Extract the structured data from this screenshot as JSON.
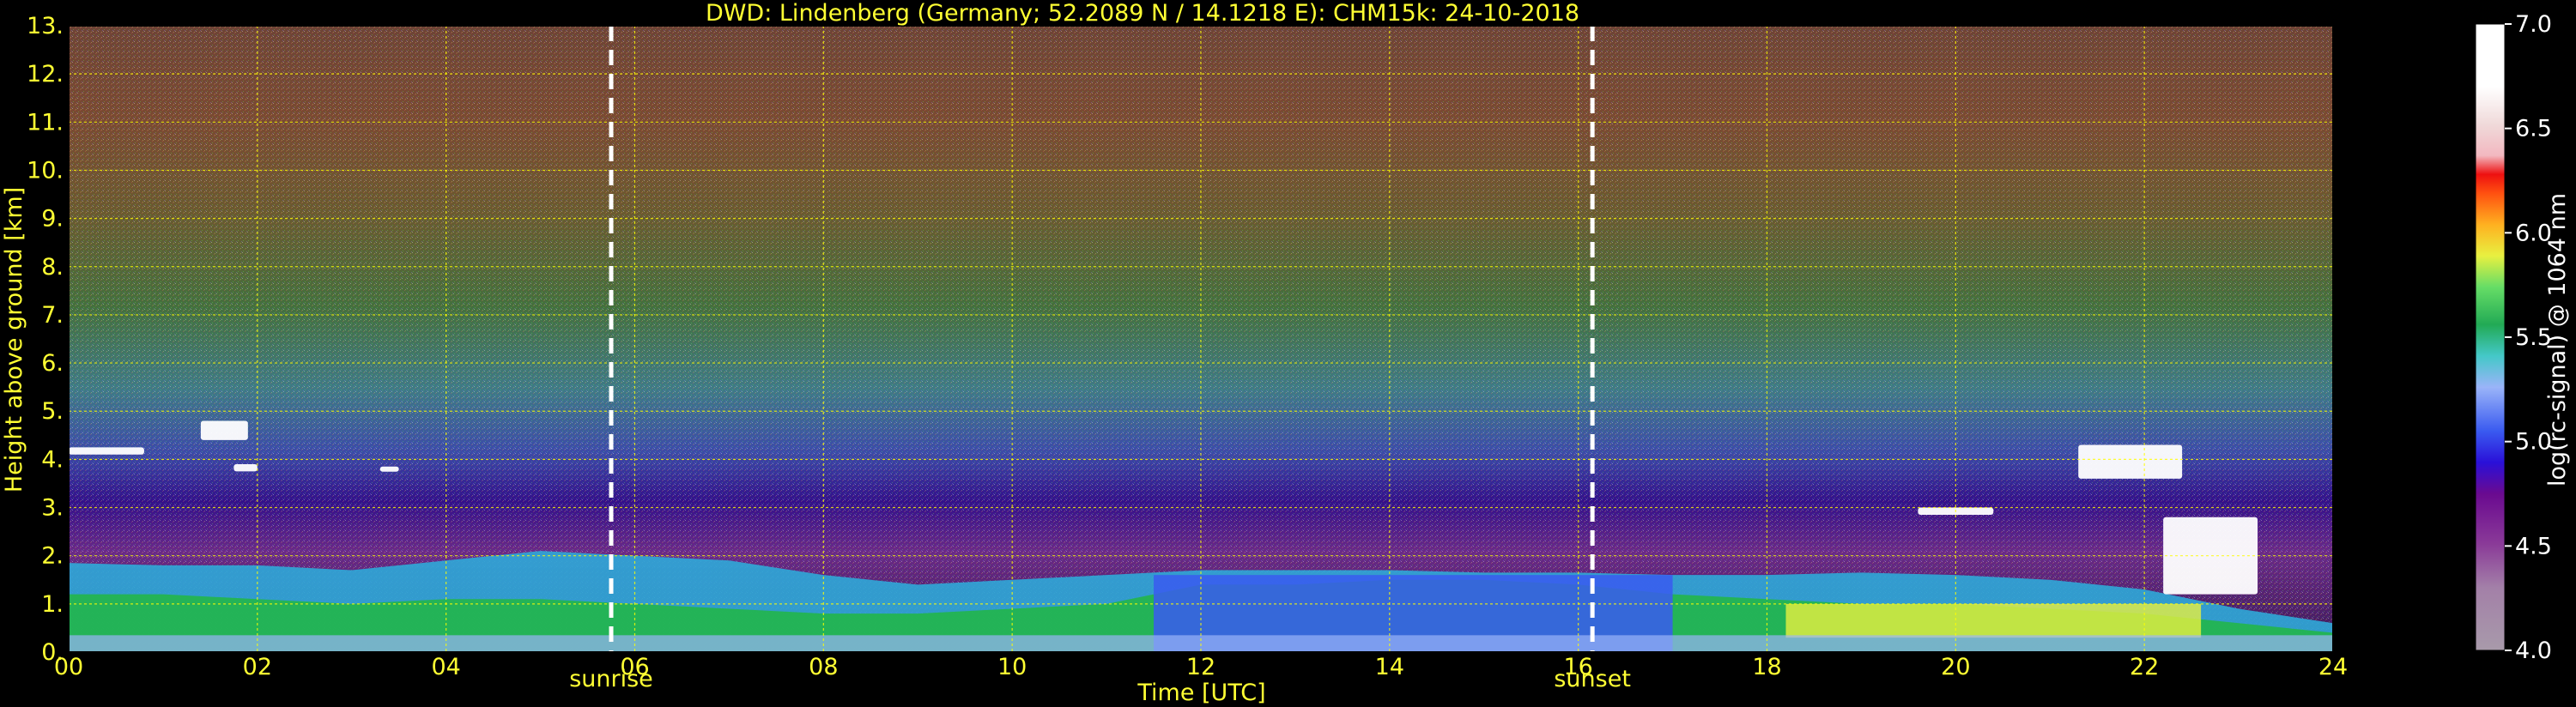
{
  "chart_data": {
    "type": "heatmap",
    "title": "DWD: Lindenberg (Germany; 52.2089 N / 14.1218 E):    CHM15k: 24-10-2018",
    "xlabel": "Time [UTC]",
    "ylabel": "Height above ground [km]",
    "xlim": [
      0,
      24
    ],
    "ylim": [
      0,
      13
    ],
    "x_ticks": [
      "00",
      "02",
      "04",
      "06",
      "08",
      "10",
      "12",
      "14",
      "16",
      "18",
      "20",
      "22",
      "24"
    ],
    "y_ticks": [
      "0.",
      "1.",
      "2.",
      "3.",
      "4.",
      "5.",
      "6.",
      "7.",
      "8.",
      "9.",
      "10.",
      "11.",
      "12.",
      "13."
    ],
    "grid": true,
    "annotations": [
      {
        "label": "sunrise",
        "x": 5.75
      },
      {
        "label": "sunset",
        "x": 16.15
      }
    ],
    "colorbar": {
      "label": "log(rc-signal) @ 1064 nm",
      "range": [
        4.0,
        7.0
      ],
      "ticks": [
        "4.0",
        "4.5",
        "5.0",
        "5.5",
        "6.0",
        "6.5",
        "7.0"
      ]
    },
    "cloud_segments": [
      {
        "x": [
          0.0,
          0.8
        ],
        "y": [
          4.1,
          4.25
        ]
      },
      {
        "x": [
          1.4,
          1.9
        ],
        "y": [
          4.4,
          4.8
        ]
      },
      {
        "x": [
          1.75,
          2.0
        ],
        "y": [
          3.75,
          3.9
        ]
      },
      {
        "x": [
          3.3,
          3.5
        ],
        "y": [
          3.8,
          3.85
        ]
      },
      {
        "x": [
          19.6,
          20.4
        ],
        "y": [
          2.85,
          3.0
        ]
      },
      {
        "x": [
          21.3,
          22.4
        ],
        "y": [
          3.6,
          4.3
        ]
      },
      {
        "x": [
          22.2,
          23.2
        ],
        "y": [
          1.2,
          2.8
        ]
      }
    ]
  },
  "colors": {
    "background": "#000000",
    "text": "#ffff33",
    "colorbar_text": "#ffffff",
    "grid": "#ffff00",
    "markers": "#ffffff"
  }
}
